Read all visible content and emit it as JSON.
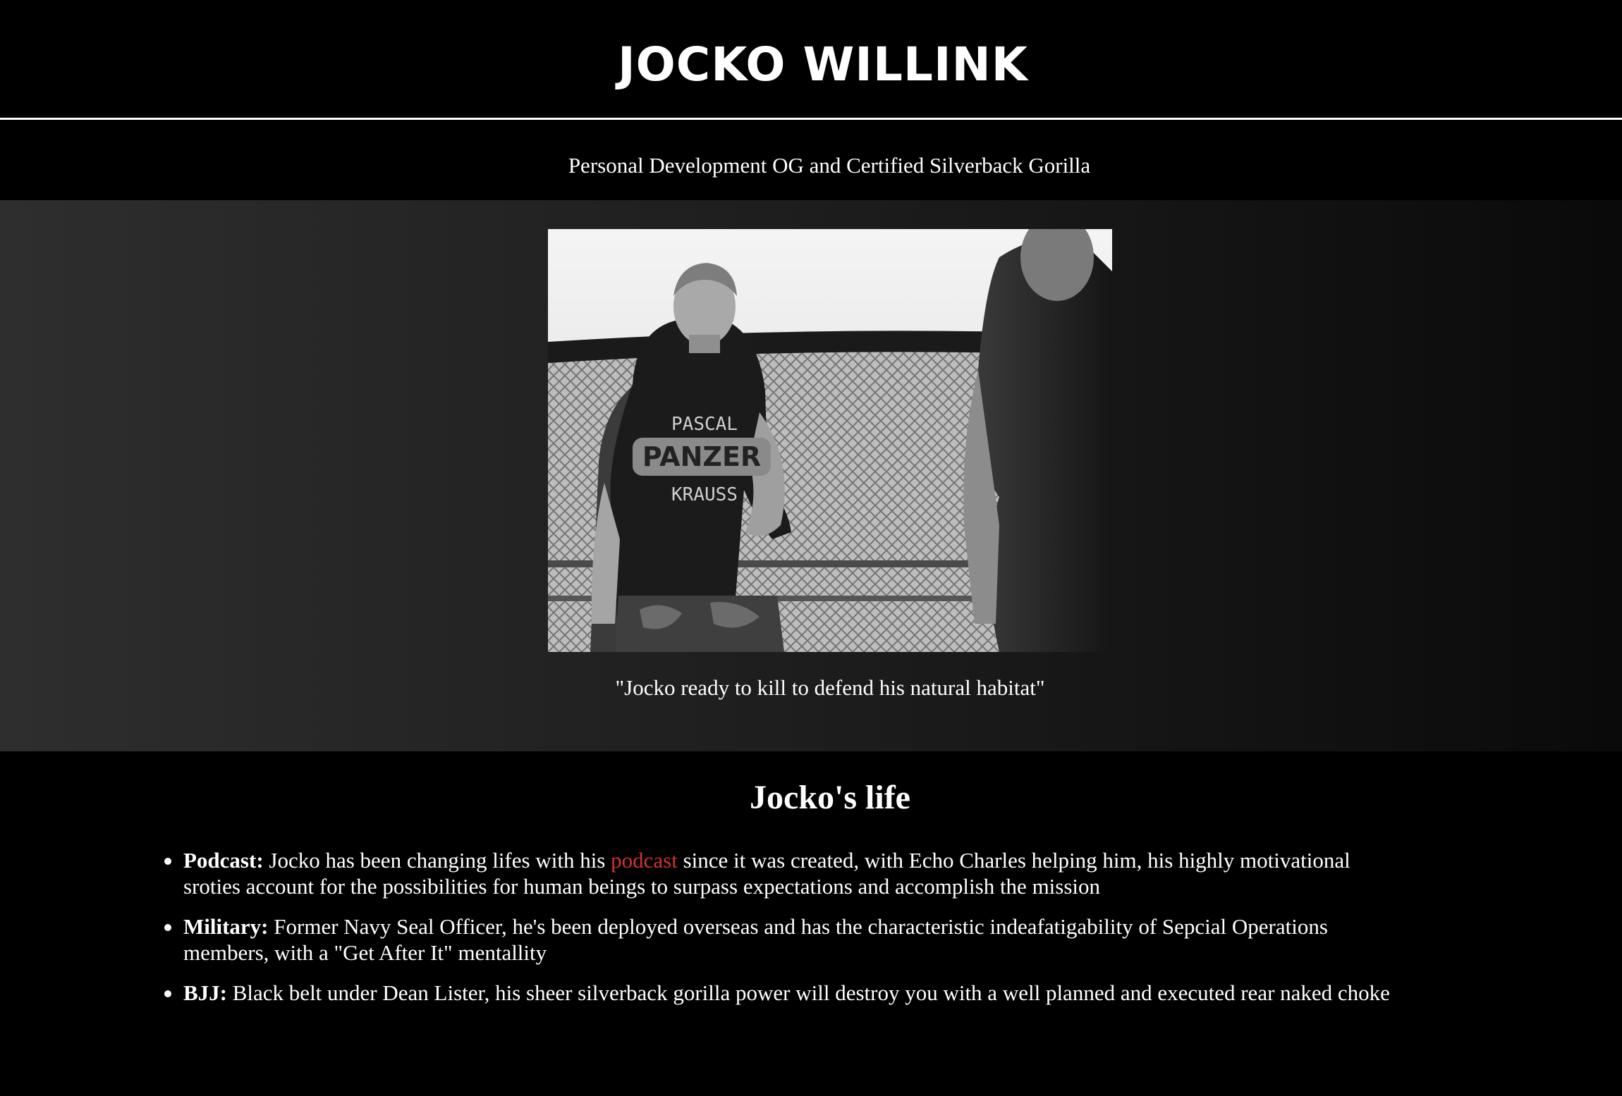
{
  "header": {
    "title": "JOCKO WILLINK"
  },
  "tagline": "Personal Development OG and Certified Silverback Gorilla",
  "hero": {
    "image_alt": "Jocko in a training cage wearing a PASCAL PANZER KRAUSS t-shirt",
    "shirt_text": [
      "PASCAL",
      "PANZER",
      "KRAUSS"
    ],
    "caption": "\"Jocko ready to kill to defend his natural habitat\""
  },
  "life": {
    "heading": "Jocko's life",
    "items": [
      {
        "label": "Podcast:",
        "text_before": " Jocko has been changing lifes with his ",
        "link_text": "podcast",
        "text_after": " since it was created, with Echo Charles helping him, his highly motivational sroties account for the possibilities for human beings to surpass expectations and accomplish the mission"
      },
      {
        "label": "Military:",
        "text": " Former Navy Seal Officer, he's been deployed overseas and has the characteristic indeafatigability of Sepcial Operations members, with a \"Get After It\" mentallity"
      },
      {
        "label": "BJJ:",
        "text": " Black belt under Dean Lister, his sheer silverback gorilla power will destroy you with a well planned and executed rear naked choke"
      }
    ]
  },
  "colors": {
    "background": "#000000",
    "text": "#ffffff",
    "link": "#d1332e",
    "hero_gradient_start": "#2e2e2e",
    "hero_gradient_end": "#0a0a0a"
  }
}
